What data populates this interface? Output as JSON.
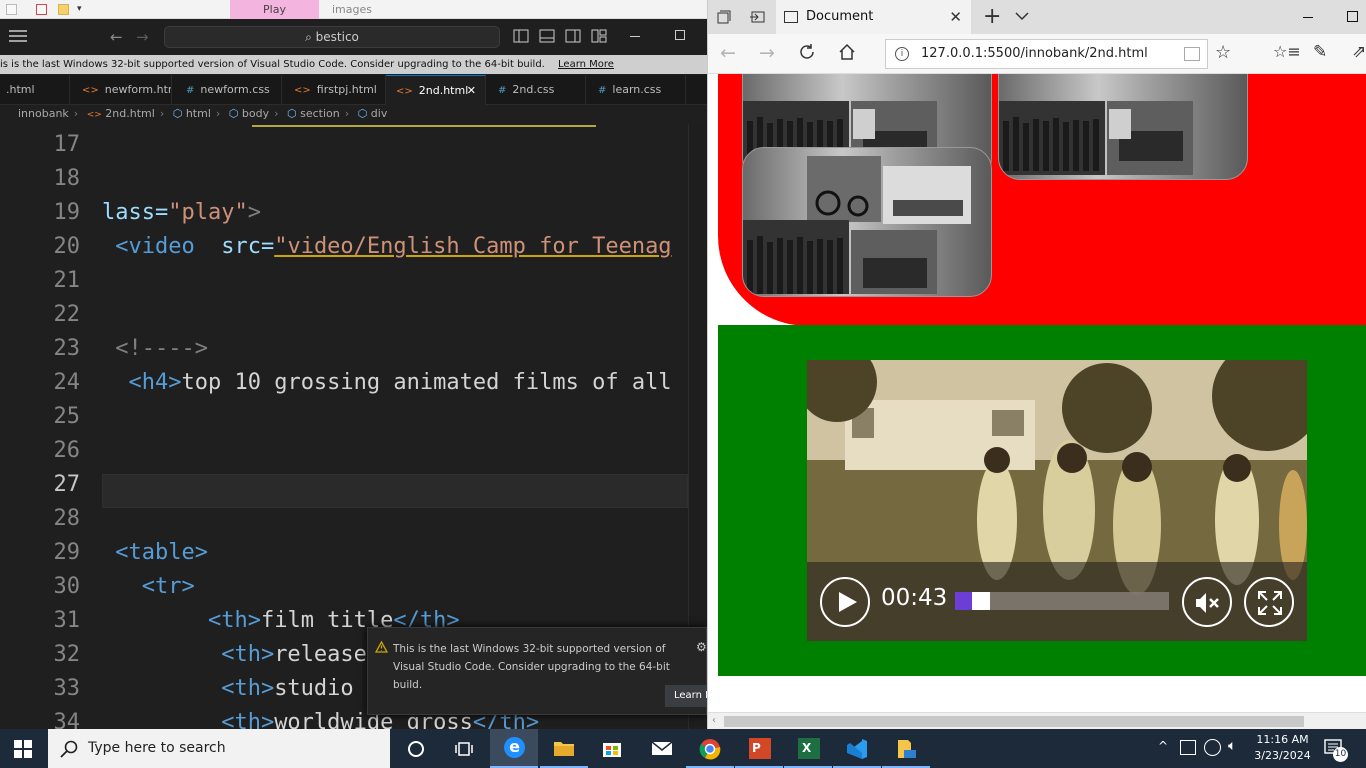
{
  "explorer_strip": {
    "play_tab": "Play",
    "crumb": "images"
  },
  "vscode": {
    "search_text": "bestico",
    "banner": {
      "text": "is is the last Windows 32-bit supported version of Visual Studio Code. Consider upgrading to the 64-bit build.",
      "link": "Learn More"
    },
    "tabs": [
      {
        "label": ".html",
        "icon": "<>"
      },
      {
        "label": "newform.html",
        "icon": "<>"
      },
      {
        "label": "newform.css",
        "icon": "#"
      },
      {
        "label": "firstpj.html",
        "icon": "<>"
      },
      {
        "label": "2nd.html",
        "icon": "<>",
        "close": "✕"
      },
      {
        "label": "2nd.css",
        "icon": "#"
      },
      {
        "label": "learn.css",
        "icon": "#"
      }
    ],
    "breadcrumbs": [
      "innobank",
      "2nd.html",
      "html",
      "body",
      "section",
      "div"
    ],
    "line_numbers": [
      "17",
      "18",
      "19",
      "20",
      "21",
      "22",
      "23",
      "24",
      "25",
      "26",
      "27",
      "28",
      "29",
      "30",
      "31",
      "32",
      "33",
      "34"
    ],
    "code": {
      "l19": {
        "a": "lass=",
        "b": "\"play\"",
        "c": ">"
      },
      "l20": {
        "a": " <video",
        "b": "  src=",
        "c": "\"video/English Camp for Teenag"
      },
      "l23": " <!---->",
      "l24": {
        "a": "  <h4>",
        "b": "top 10 grossing animated films of all"
      },
      "l29": " <table>",
      "l30": "   <tr>",
      "l31": {
        "a": "        <th>",
        "b": "film title",
        "c": "</th>"
      },
      "l32": {
        "a": "         <th>",
        "b": "release"
      },
      "l33": {
        "a": "         <th>",
        "b": "studio"
      },
      "l34": {
        "a": "         <th>",
        "b": "worldwide gross",
        "c": "</th>"
      }
    },
    "toast": {
      "text": "This is the last Windows 32-bit supported version of Visual Studio Code. Consider upgrading to the 64-bit build.",
      "button": "Learn M"
    }
  },
  "browser": {
    "tab_title": "Document",
    "url": "127.0.0.1:5500/innobank/2nd.html",
    "video": {
      "time": "00:43",
      "progress_fraction": 0.08
    },
    "section_colors": {
      "red": "#ff0000",
      "green": "#008000"
    }
  },
  "taskbar": {
    "search_placeholder": "Type here to search",
    "time": "11:16 AM",
    "date": "3/23/2024",
    "notification_count": "10",
    "apps": [
      "task-view",
      "edge",
      "file-explorer",
      "store",
      "mail",
      "chrome",
      "powerpoint",
      "excel",
      "vscode",
      "file-folder"
    ]
  }
}
